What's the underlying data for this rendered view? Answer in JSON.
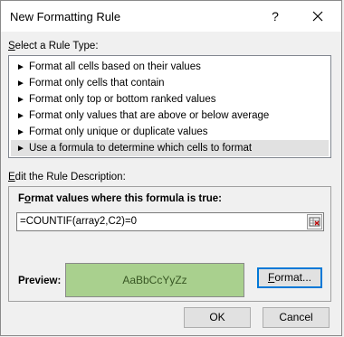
{
  "dialog": {
    "title": "New Formatting Rule",
    "help_label": "?",
    "close_icon": "close-icon"
  },
  "rule_type": {
    "label_accel": "S",
    "label_rest": "elect a Rule Type:",
    "items": [
      {
        "label": "Format all cells based on their values",
        "selected": false
      },
      {
        "label": "Format only cells that contain",
        "selected": false
      },
      {
        "label": "Format only top or bottom ranked values",
        "selected": false
      },
      {
        "label": "Format only values that are above or below average",
        "selected": false
      },
      {
        "label": "Format only unique or duplicate values",
        "selected": false
      },
      {
        "label": "Use a formula to determine which cells to format",
        "selected": true
      }
    ]
  },
  "description": {
    "label_accel": "E",
    "label_rest": "dit the Rule Description:",
    "formula_label_accel": "o",
    "formula_label_pre": "F",
    "formula_label_rest": "rmat values where this formula is true:",
    "formula_value": "=COUNTIF(array2,C2)=0",
    "preview_label": "Preview:",
    "preview_text": "AaBbCcYyZz",
    "preview_color": "#a9d08e",
    "format_label_accel": "F",
    "format_label_rest": "ormat..."
  },
  "buttons": {
    "ok": "OK",
    "cancel": "Cancel"
  }
}
